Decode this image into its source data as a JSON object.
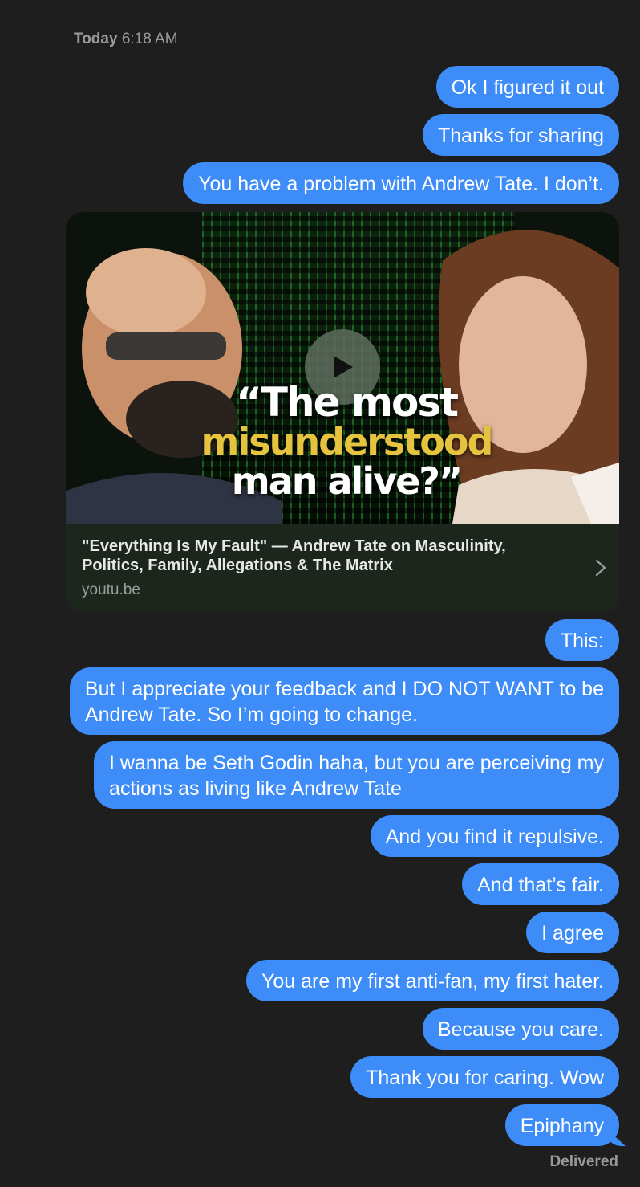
{
  "timestamp": {
    "day": "Today",
    "time": "6:18 AM"
  },
  "messages": {
    "m1": "Ok I figured it out",
    "m2": "Thanks for sharing",
    "m3": "You have a problem with Andrew Tate. I don’t.",
    "m4": "This:",
    "m5": "But I appreciate your feedback and I DO NOT WANT to be\nAndrew Tate. So I’m going to change.",
    "m6": "I wanna be Seth Godin haha, but you are perceiving my\nactions as living like Andrew Tate",
    "m7": "And you find it repulsive.",
    "m8": "And that’s fair.",
    "m9": "I agree",
    "m10": "You are my first anti-fan, my first hater.",
    "m11": "Because you care.",
    "m12": "Thank you for caring. Wow",
    "m13": "Epiphany"
  },
  "link_preview": {
    "thumb_line1": "“The most",
    "thumb_line2": "misunderstood",
    "thumb_line3": "man alive?”",
    "title": "\"Everything Is My Fault\" — Andrew Tate on Masculinity, Politics, Family, Allegations & The Matrix",
    "domain": "youtu.be"
  },
  "status": "Delivered",
  "colors": {
    "background": "#1e1e1e",
    "bubble": "#3d8cf7",
    "secondary_text": "#9a9a9a",
    "thumb_highlight": "#e5c33f"
  }
}
